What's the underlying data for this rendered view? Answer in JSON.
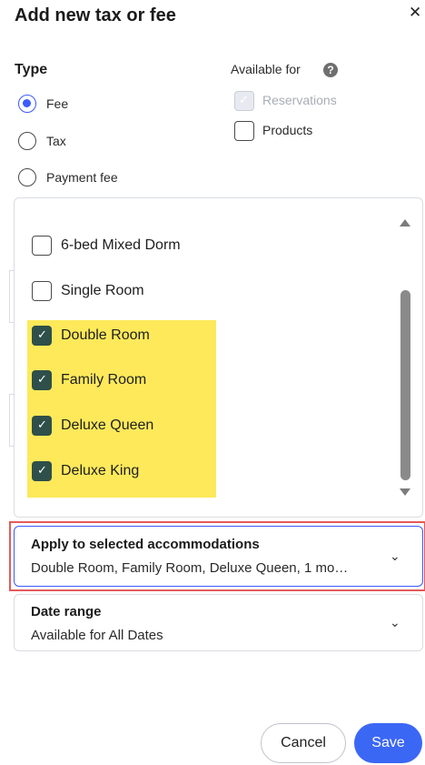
{
  "dialog": {
    "title": "Add new tax or fee",
    "close_icon": "close-icon"
  },
  "type_section": {
    "label": "Type",
    "options": [
      {
        "label": "Fee",
        "selected": true
      },
      {
        "label": "Tax",
        "selected": false
      },
      {
        "label": "Payment fee",
        "selected": false
      }
    ]
  },
  "available_for": {
    "label": "Available for",
    "help_icon": "question-icon",
    "help_glyph": "?",
    "options": [
      {
        "label": "Reservations",
        "checked": true,
        "disabled": true
      },
      {
        "label": "Products",
        "checked": false,
        "disabled": false
      }
    ]
  },
  "accommodations_list": {
    "items": [
      {
        "label": "6-bed Mixed Dorm",
        "checked": false
      },
      {
        "label": "Single Room",
        "checked": false
      },
      {
        "label": "Double Room",
        "checked": true
      },
      {
        "label": "Family Room",
        "checked": true
      },
      {
        "label": "Deluxe Queen",
        "checked": true
      },
      {
        "label": "Deluxe King",
        "checked": true
      }
    ]
  },
  "apply_field": {
    "title": "Apply to selected accommodations",
    "value": "Double Room, Family Room, Deluxe Queen, 1 mo…",
    "chevron_icon": "chevron-down-icon"
  },
  "date_range": {
    "title": "Date range",
    "value": "Available for All Dates",
    "chevron_icon": "chevron-down-icon"
  },
  "footer": {
    "cancel_label": "Cancel",
    "save_label": "Save"
  },
  "colors": {
    "accent": "#3b67f5",
    "checked_box": "#2f4f4a",
    "highlight": "#fde95a",
    "focus_outline": "#e35a5a"
  }
}
